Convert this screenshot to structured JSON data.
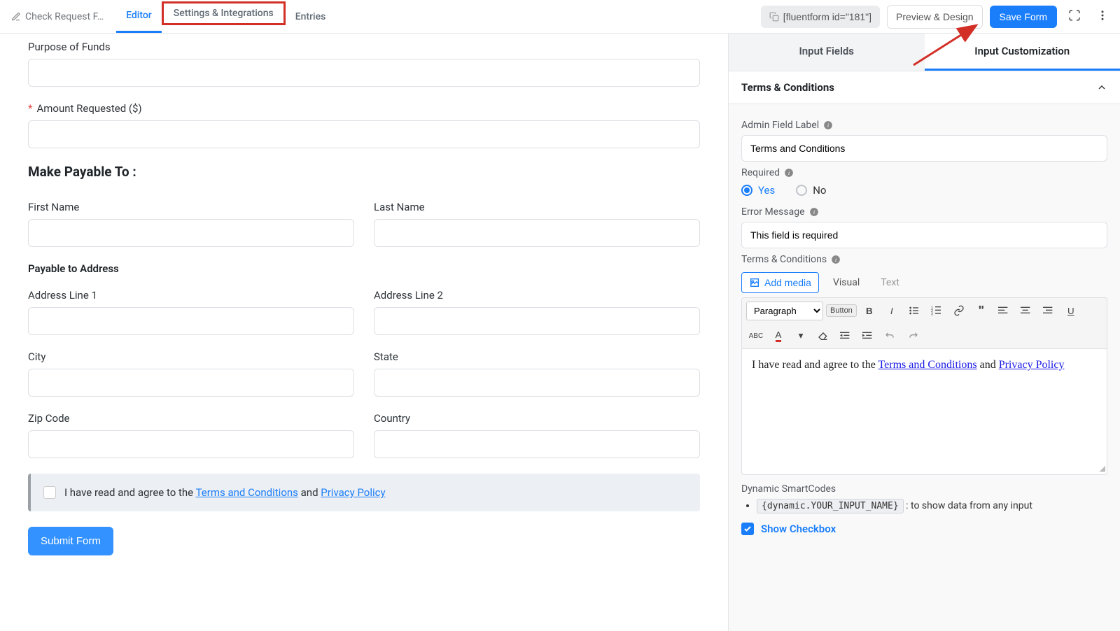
{
  "topbar": {
    "form_title": "Check Request F…",
    "tabs": {
      "editor": "Editor",
      "settings": "Settings & Integrations",
      "entries": "Entries"
    },
    "shortcode": "[fluentform id=\"181\"]",
    "preview": "Preview & Design",
    "save": "Save Form"
  },
  "form": {
    "purpose_label": "Purpose of Funds",
    "amount_label": "Amount Requested ($)",
    "payable_heading": "Make Payable To :",
    "first_name": "First Name",
    "last_name": "Last Name",
    "address_heading": "Payable to Address",
    "addr1": "Address Line 1",
    "addr2": "Address Line 2",
    "city": "City",
    "state": "State",
    "zip": "Zip Code",
    "country": "Country",
    "terms_prefix": "I have read and agree to the ",
    "terms_link1": "Terms and Conditions",
    "terms_and": " and ",
    "terms_link2": "Privacy Policy",
    "submit": "Submit Form"
  },
  "sidebar": {
    "tab_fields": "Input Fields",
    "tab_custom": "Input Customization",
    "panel_title": "Terms & Conditions",
    "admin_label": "Admin Field Label",
    "admin_value": "Terms and Conditions",
    "required_label": "Required",
    "required_yes": "Yes",
    "required_no": "No",
    "error_label": "Error Message",
    "error_value": "This field is required",
    "tnc_label": "Terms & Conditions",
    "add_media": "Add media",
    "visual": "Visual",
    "text_tab": "Text",
    "paragraph": "Paragraph",
    "button_insert": "Button",
    "editor_prefix": "I have read and agree to the ",
    "editor_link1": "Terms and Conditions",
    "editor_mid": " and ",
    "editor_link2": "Privacy Policy",
    "smart_label": "Dynamic SmartCodes",
    "smart_code": "{dynamic.YOUR_INPUT_NAME}",
    "smart_desc": " : to show data from any input",
    "show_checkbox": "Show Checkbox"
  }
}
